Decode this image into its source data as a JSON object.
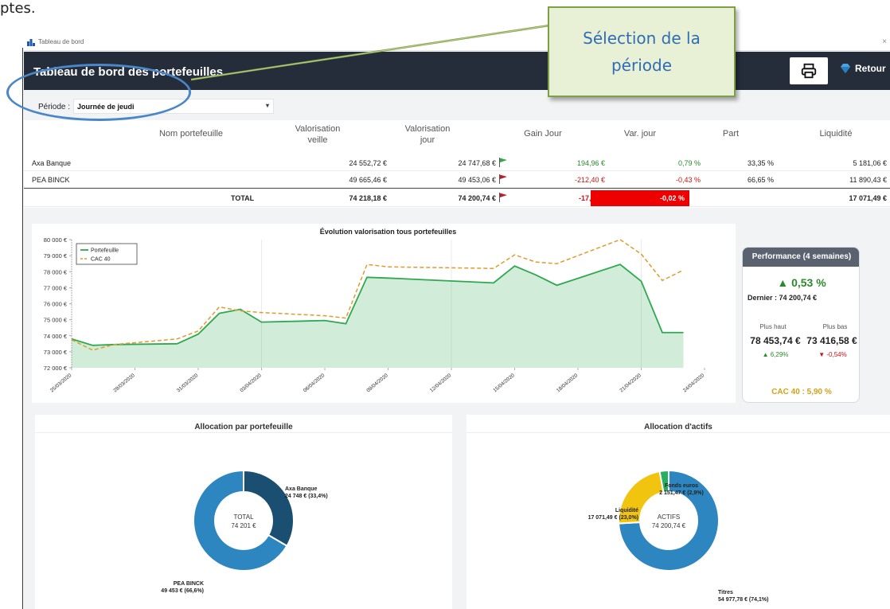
{
  "doc": {
    "fragment": "ptes."
  },
  "window": {
    "title": "Tableau de bord"
  },
  "header": {
    "title": "Tableau de bord des portefeuilles",
    "retour_label": "Retour"
  },
  "callout": {
    "line1": "Sélection de la",
    "line2": "période"
  },
  "period": {
    "label": "Période :",
    "value": "Journée de jeudi"
  },
  "table": {
    "headers": {
      "name": "Nom portefeuille",
      "val_veille_1": "Valorisation",
      "val_veille_2": "veille",
      "val_jour_1": "Valorisation",
      "val_jour_2": "jour",
      "gain": "Gain Jour",
      "var": "Var. jour",
      "part": "Part",
      "liq": "Liquidité"
    },
    "rows": [
      {
        "name": "Axa Banque",
        "veille": "24 552,72 €",
        "jour": "24 747,68 €",
        "gain": "194,96 €",
        "var": "0,79 %",
        "part": "33,35 %",
        "liq": "5 181,06 €",
        "flag": "green"
      },
      {
        "name": "PEA BINCK",
        "veille": "49 665,46 €",
        "jour": "49 453,06 €",
        "gain": "-212,40 €",
        "var": "-0,43 %",
        "part": "66,65 %",
        "liq": "11 890,43 €",
        "flag": "red"
      }
    ],
    "total": {
      "label": "TOTAL",
      "veille": "74 218,18 €",
      "jour": "74 200,74 €",
      "gain": "-17,44 €",
      "var": "-0,02 %",
      "liq": "17 071,49 €",
      "flag": "red"
    }
  },
  "perf": {
    "title": "Performance (4 semaines)",
    "change": "▲ 0,53 %",
    "last": "Dernier : 74 200,74 €",
    "high_label": "Plus haut",
    "low_label": "Plus bas",
    "high_value": "78 453,74 €",
    "low_value": "73 416,58 €",
    "high_pct": "▲ 6,29%",
    "low_pct": "▼ -0,54%",
    "cac": "CAC 40 : 5,90 %",
    "colors": {
      "up": "#2a8a2a",
      "down": "#cc1111",
      "cac": "#d4a017"
    }
  },
  "chart_data": [
    {
      "type": "area",
      "title": "Évolution valorisation tous portefeuilles",
      "x": [
        "25/03/2020",
        "26/03/2020",
        "27/03/2020",
        "30/03/2020",
        "31/03/2020",
        "01/04/2020",
        "02/04/2020",
        "03/04/2020",
        "06/04/2020",
        "07/04/2020",
        "08/04/2020",
        "09/04/2020",
        "14/04/2020",
        "15/04/2020",
        "16/04/2020",
        "17/04/2020",
        "20/04/2020",
        "21/04/2020",
        "22/04/2020",
        "23/04/2020"
      ],
      "x_tick_labels": [
        "25/03/2020",
        "28/03/2020",
        "31/03/2020",
        "03/04/2020",
        "06/04/2020",
        "09/04/2020",
        "12/04/2020",
        "15/04/2020",
        "18/04/2020",
        "21/04/2020",
        "24/04/2020"
      ],
      "series": [
        {
          "name": "Portefeuille",
          "color": "#2fa84f",
          "values": [
            73800,
            73400,
            73450,
            73500,
            74100,
            75400,
            75650,
            74850,
            74950,
            74750,
            77650,
            77600,
            77300,
            78350,
            77800,
            77150,
            78450,
            77400,
            74200,
            74200
          ]
        },
        {
          "name": "CAC 40",
          "color": "#e09b2d",
          "values": [
            73750,
            73100,
            73450,
            73800,
            74300,
            75800,
            75550,
            75450,
            75250,
            75100,
            78450,
            78300,
            78200,
            79050,
            78600,
            78500,
            80000,
            79100,
            77450,
            78100
          ]
        }
      ],
      "y_tick_labels": [
        "72 000 €",
        "73 000 €",
        "74 000 €",
        "75 000 €",
        "76 000 €",
        "77 000 €",
        "78 000 €",
        "79 000 €",
        "80 000 €"
      ],
      "ylim": [
        72000,
        80000
      ],
      "legend": "top-left"
    },
    {
      "type": "pie",
      "title": "Allocation par portefeuille",
      "center_label": "TOTAL",
      "center_value": "74 201 €",
      "slices": [
        {
          "label": "Axa Banque",
          "value_label": "24 748 € (33,4%)",
          "value": 33.4,
          "color": "#1b4f72"
        },
        {
          "label": "PEA BINCK",
          "value_label": "49 453 € (66,6%)",
          "value": 66.6,
          "color": "#2e86c1"
        }
      ]
    },
    {
      "type": "pie",
      "title": "Allocation d'actifs",
      "center_label": "ACTIFS",
      "center_value": "74 200,74 €",
      "slices": [
        {
          "label": "Titres",
          "value_label": "54 977,78 € (74,1%)",
          "value": 74.1,
          "color": "#2e86c1"
        },
        {
          "label": "Liquidité",
          "value_label": "17 071,49 € (23,0%)",
          "value": 23.0,
          "color": "#f1c40f"
        },
        {
          "label": "Fonds euros",
          "value_label": "2 151,47 € (2,9%)",
          "value": 2.9,
          "color": "#27ae60"
        }
      ]
    }
  ]
}
